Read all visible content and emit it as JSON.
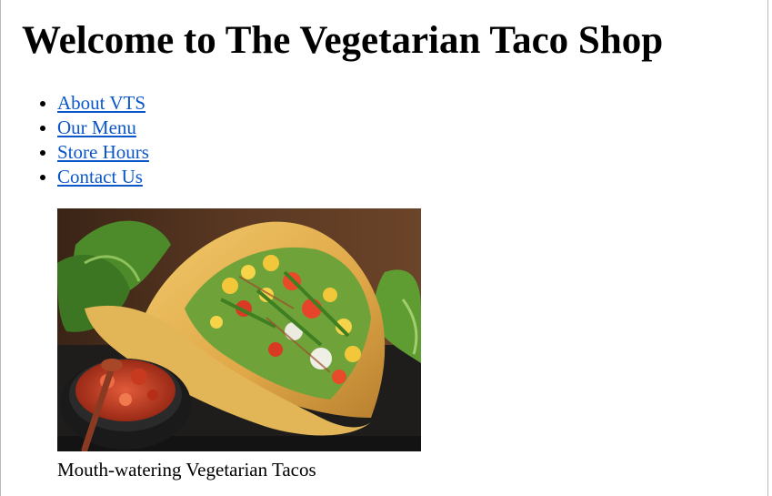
{
  "page": {
    "heading": "Welcome to The Vegetarian Taco Shop"
  },
  "nav": {
    "items": [
      {
        "label": "About VTS",
        "name": "nav-link-about"
      },
      {
        "label": "Our Menu",
        "name": "nav-link-menu"
      },
      {
        "label": "Store Hours",
        "name": "nav-link-hours"
      },
      {
        "label": "Contact Us",
        "name": "nav-link-contact"
      }
    ],
    "link_color": "#0b57c9"
  },
  "figure": {
    "caption": "Mouth-watering Vegetarian Tacos"
  }
}
